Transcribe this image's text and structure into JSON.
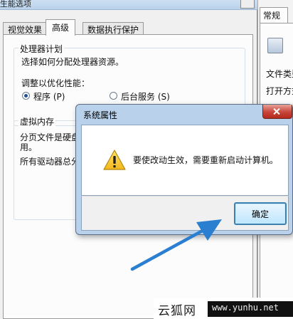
{
  "perf_window": {
    "title": "生能选项",
    "tabs": [
      {
        "label": "视觉效果",
        "active": false
      },
      {
        "label": "高级",
        "active": true
      },
      {
        "label": "数据执行保护",
        "active": false
      }
    ],
    "processor_group": {
      "legend": "处理器计划",
      "description": "选择如何分配处理器资源。",
      "adjust_label": "调整以优化性能：",
      "options": [
        {
          "label": "程序 (P)",
          "selected": true
        },
        {
          "label": "后台服务 (S)",
          "selected": false
        }
      ]
    },
    "vm_group": {
      "legend": "虚拟内存",
      "line1": "分页文件是硬盘",
      "line2": "用。",
      "line3": "所有驱动器总分"
    }
  },
  "side_window": {
    "tab_label": "常规",
    "line1": "文件类型",
    "line2": "打开方式"
  },
  "dialog": {
    "title": "系统属性",
    "message": "要使改动生效，需要重新启动计算机。",
    "ok_label": "确定",
    "accent_color": "#3c7fb1"
  },
  "arrow_color": "#2a7fd0",
  "watermark": {
    "site_name": "云狐网",
    "url": "www.yunhu.net"
  }
}
